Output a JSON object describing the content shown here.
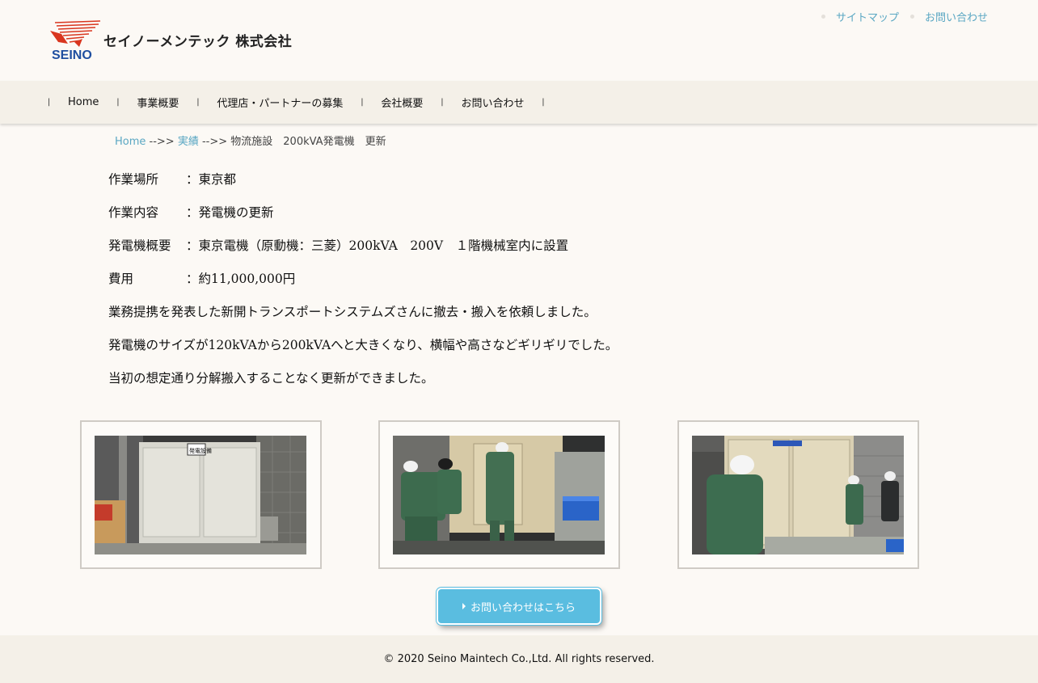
{
  "header": {
    "company_name": "セイノーメンテック 株式会社",
    "logo_text": "SEINO",
    "top_links": [
      "サイトマップ",
      "お問い合わせ"
    ]
  },
  "nav": {
    "items": [
      "Home",
      "事業概要",
      "代理店・パートナーの募集",
      "会社概要",
      "お問い合わせ"
    ]
  },
  "breadcrumb": {
    "home": "Home",
    "sep1": " -->> ",
    "works": "実績",
    "sep2": " -->> ",
    "current": "物流施設　200kVA発電機　更新"
  },
  "content": {
    "location_label": "作業場所",
    "location_value": "：東京都",
    "work_label": "作業内容",
    "work_value": "：発電機の更新",
    "overview_label": "発電機概要",
    "overview_value": "：東京電機（原動機：三菱）200kVA　200V　１階機械室内に設置",
    "cost_label": "費用",
    "cost_value": "：約11,000,000円",
    "paragraphs": [
      "業務提携を発表した新開トランスポートシステムズさんに撤去・搬入を依頼しました。",
      "発電機のサイズが120kVAから200kVAへと大きくなり、横幅や高さなどギリギリでした。",
      "当初の想定通り分解搬入することなく更新ができました。"
    ]
  },
  "photos": {
    "labels": [
      "発電設備"
    ]
  },
  "contact_button": "お問い合わせはこちら",
  "footer": "© 2020 Seino Maintech Co.,Ltd. All rights reserved.",
  "colors": {
    "background": "#fcf9f5",
    "nav_bg": "#f4f0e8",
    "link": "#5aa7c3",
    "button": "#5abde0",
    "logo_red": "#d9361f",
    "logo_blue": "#1f4fa0"
  }
}
